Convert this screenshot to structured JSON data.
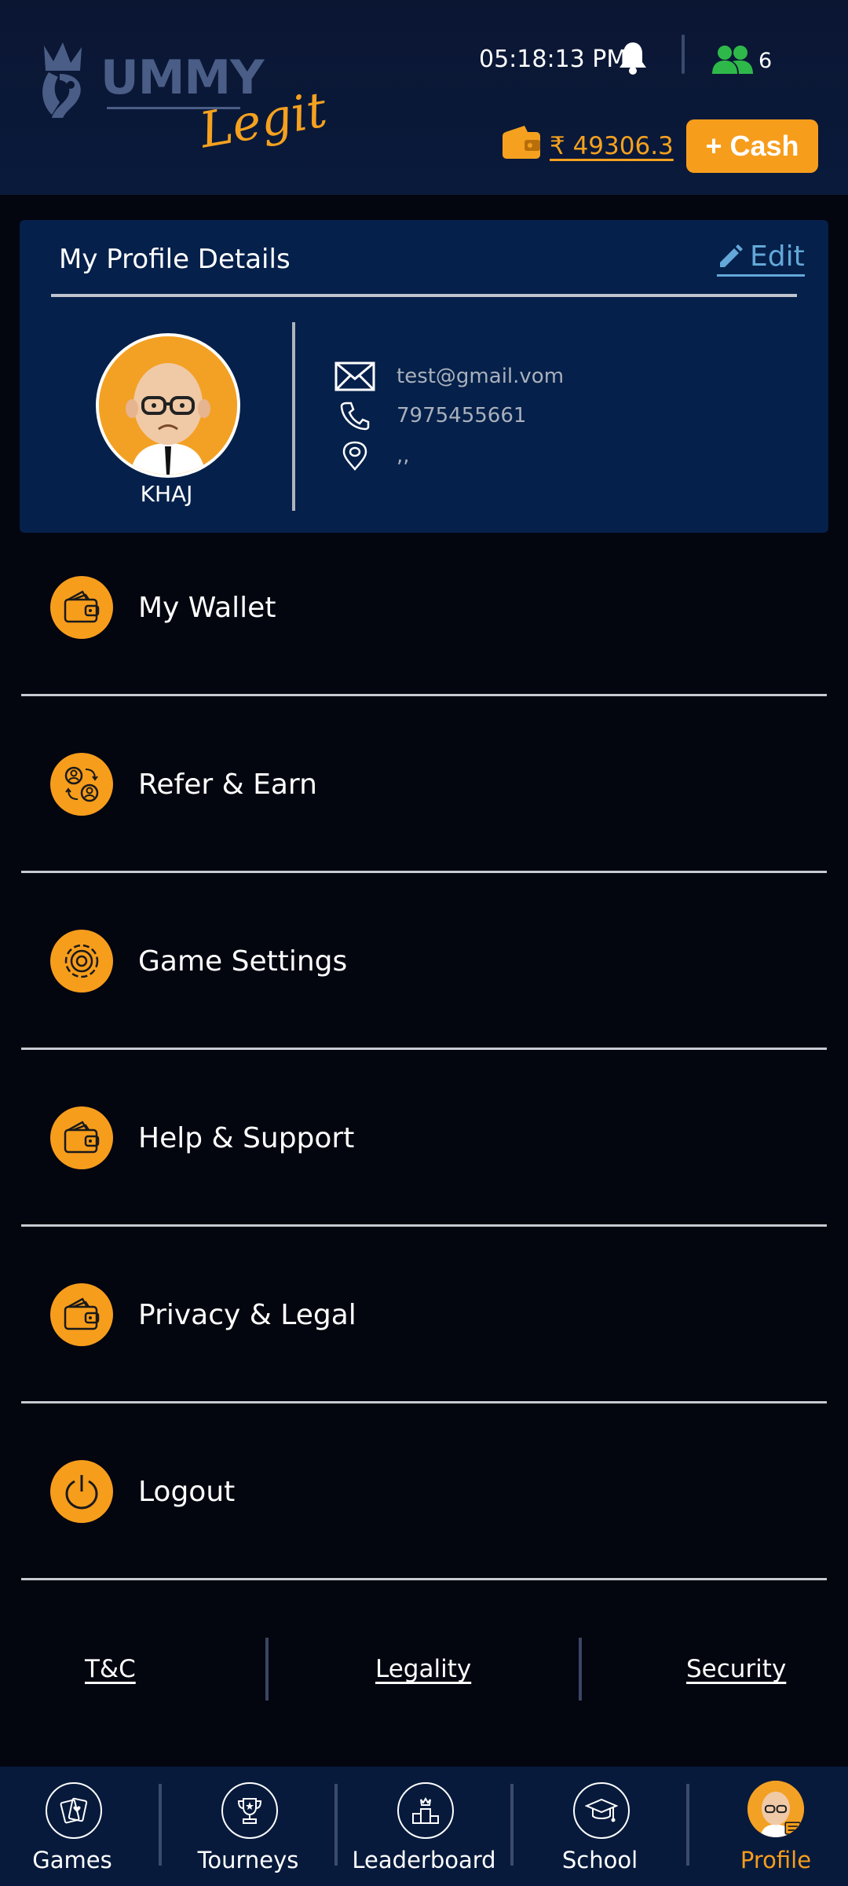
{
  "header": {
    "logo_text_main": "UMMY",
    "logo_text_script": "Legit",
    "time": "05:18:13 PM",
    "online_count": "6",
    "balance": "₹ 49306.3",
    "add_cash_label": "+ Cash"
  },
  "profile": {
    "title": "My Profile Details",
    "edit_label": "Edit",
    "name": "KHAJ",
    "email": "test@gmail.vom",
    "phone": "7975455661",
    "address": ",,"
  },
  "menu": [
    {
      "label": "My Wallet",
      "icon": "wallet-icon"
    },
    {
      "label": "Refer & Earn",
      "icon": "refer-icon"
    },
    {
      "label": "Game Settings",
      "icon": "settings-gear-icon"
    },
    {
      "label": "Help & Support",
      "icon": "wallet-icon"
    },
    {
      "label": "Privacy & Legal",
      "icon": "wallet-icon"
    },
    {
      "label": "Logout",
      "icon": "power-icon"
    }
  ],
  "footer_links": {
    "tnc": "T&C",
    "legality": "Legality",
    "security": "Security"
  },
  "bottom_nav": [
    {
      "label": "Games",
      "icon": "cards-icon"
    },
    {
      "label": "Tourneys",
      "icon": "trophy-icon"
    },
    {
      "label": "Leaderboard",
      "icon": "podium-icon"
    },
    {
      "label": "School",
      "icon": "graduation-cap-icon"
    },
    {
      "label": "Profile",
      "icon": "avatar-icon",
      "active": true
    }
  ],
  "colors": {
    "accent": "#f79d1c",
    "header_bg": "#0a1a3b",
    "card_bg": "#05204a",
    "page_bg": "#03050f",
    "online_green": "#2fb84a",
    "link_blue": "#63a8d8"
  }
}
